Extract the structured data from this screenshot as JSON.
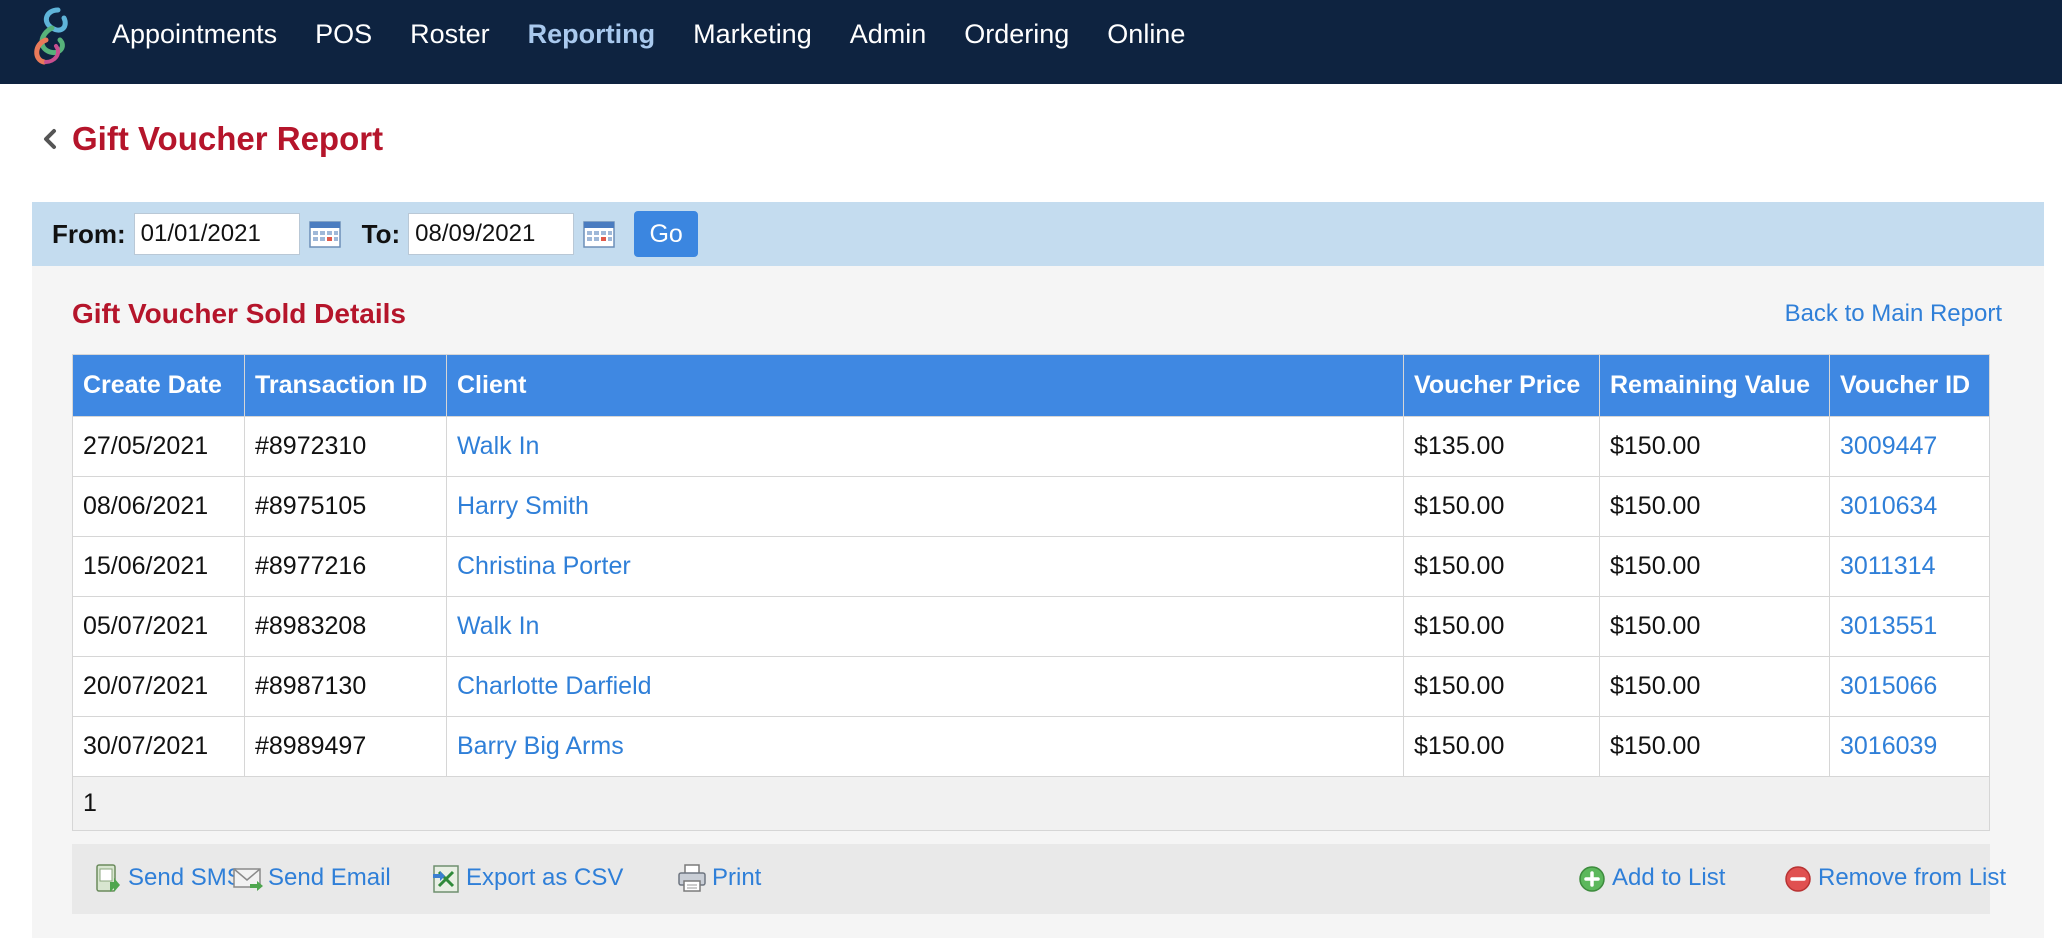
{
  "nav": {
    "items": [
      {
        "label": "Appointments",
        "active": false
      },
      {
        "label": "POS",
        "active": false
      },
      {
        "label": "Roster",
        "active": false
      },
      {
        "label": "Reporting",
        "active": true
      },
      {
        "label": "Marketing",
        "active": false
      },
      {
        "label": "Admin",
        "active": false
      },
      {
        "label": "Ordering",
        "active": false
      },
      {
        "label": "Online",
        "active": false
      }
    ]
  },
  "page": {
    "title": "Gift Voucher Report"
  },
  "filter": {
    "from_label": "From:",
    "from_value": "01/01/2021",
    "to_label": "To:",
    "to_value": "08/09/2021",
    "go_label": "Go"
  },
  "section": {
    "title": "Gift Voucher Sold Details",
    "back_link": "Back to Main Report"
  },
  "table": {
    "columns": [
      "Create Date",
      "Transaction ID",
      "Client",
      "Voucher Price",
      "Remaining Value",
      "Voucher ID"
    ],
    "rows": [
      [
        "27/05/2021",
        "#8972310",
        "Walk In",
        "$135.00",
        "$150.00",
        "3009447"
      ],
      [
        "08/06/2021",
        "#8975105",
        "Harry Smith",
        "$150.00",
        "$150.00",
        "3010634"
      ],
      [
        "15/06/2021",
        "#8977216",
        "Christina Porter",
        "$150.00",
        "$150.00",
        "3011314"
      ],
      [
        "05/07/2021",
        "#8983208",
        "Walk In",
        "$150.00",
        "$150.00",
        "3013551"
      ],
      [
        "20/07/2021",
        "#8987130",
        "Charlotte Darfield",
        "$150.00",
        "$150.00",
        "3015066"
      ],
      [
        "30/07/2021",
        "#8989497",
        "Barry Big Arms",
        "$150.00",
        "$150.00",
        "3016039"
      ]
    ],
    "page_number": "1"
  },
  "actions": {
    "send_sms": "Send SMS",
    "send_email": "Send Email",
    "export_csv": "Export as CSV",
    "print": "Print",
    "add_to_list": "Add to List",
    "remove_from_list": "Remove from List"
  },
  "colors": {
    "nav_bg": "#0e2340",
    "nav_active": "#a9c9ee",
    "title_red": "#b5152b",
    "header_blue": "#3f88e2",
    "link_blue": "#2f7fd8",
    "filter_bg": "#c4dcef"
  },
  "icons": {
    "logo": "brand-swirl-logo",
    "back": "chevron-left-icon",
    "calendar": "calendar-icon",
    "sms": "sms-icon",
    "email": "email-icon",
    "csv": "csv-export-icon",
    "print": "printer-icon",
    "add": "plus-circle-icon",
    "remove": "minus-circle-icon"
  }
}
